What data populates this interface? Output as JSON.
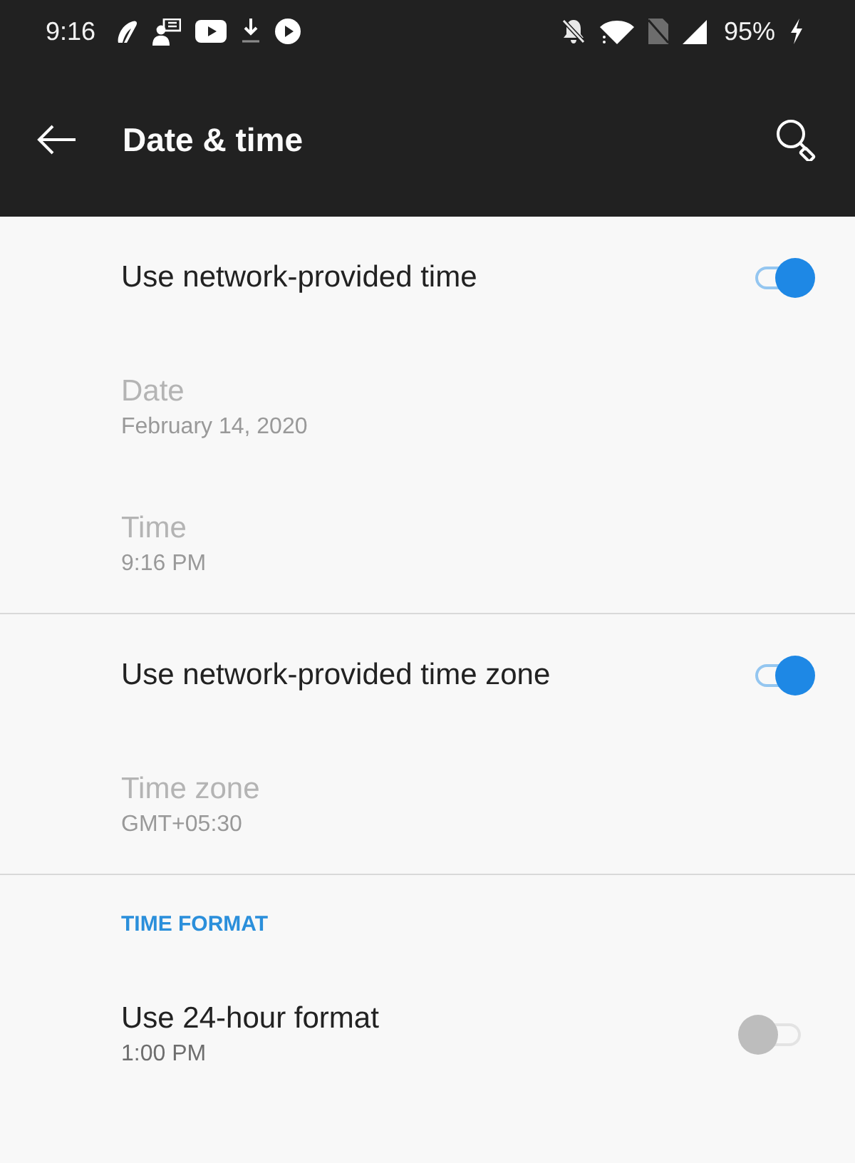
{
  "status_bar": {
    "time": "9:16",
    "battery": "95%"
  },
  "app_bar": {
    "title": "Date & time"
  },
  "sections": [
    {
      "items": [
        {
          "kind": "toggle",
          "title": "Use network-provided time",
          "on": true,
          "disabled": false
        },
        {
          "kind": "info",
          "title": "Date",
          "summary": "February 14, 2020",
          "disabled": true
        },
        {
          "kind": "info",
          "title": "Time",
          "summary": "9:16 PM",
          "disabled": true
        }
      ]
    },
    {
      "items": [
        {
          "kind": "toggle",
          "title": "Use network-provided time zone",
          "on": true,
          "disabled": false
        },
        {
          "kind": "info",
          "title": "Time zone",
          "summary": "GMT+05:30",
          "disabled": true
        }
      ]
    },
    {
      "header": "TIME FORMAT",
      "items": [
        {
          "kind": "toggle",
          "title": "Use 24-hour format",
          "summary": "1:00 PM",
          "on": false,
          "disabled": false
        }
      ]
    }
  ]
}
